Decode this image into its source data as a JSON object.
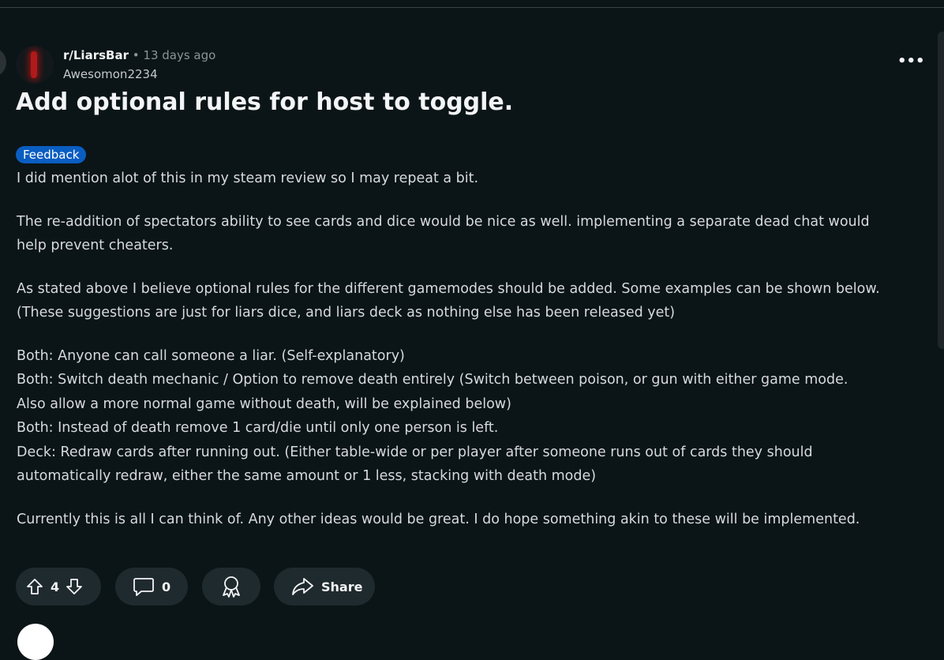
{
  "post": {
    "subreddit": "r/LiarsBar",
    "separator": "•",
    "time": "13 days ago",
    "author": "Awesomon2234",
    "more_label": "•••",
    "title": "Add optional rules for host to toggle.",
    "flair": "Feedback",
    "body": {
      "p1": "I did mention alot of this in my steam review so I may repeat a bit.",
      "p2_l1": "The re-addition of spectators ability to see cards and dice would be nice as well. implementing a separate dead chat would",
      "p2_l2": "help prevent cheaters.",
      "p3_l1": "As stated above I believe optional rules for the different gamemodes should be added. Some examples can be shown below.",
      "p3_l2": "(These suggestions are just for liars dice, and liars deck as nothing else has been released yet)",
      "p4_l1": "Both: Anyone can call someone a liar. (Self-explanatory)",
      "p4_l2": "Both: Switch death mechanic / Option to remove death entirely (Switch between poison, or gun with either game mode.",
      "p4_l3": "Also allow a more normal game without death, will be explained below)",
      "p4_l4": "Both: Instead of death remove 1 card/die until only one person is left.",
      "p4_l5": "Deck: Redraw cards after running out. (Either table-wide or per player after someone runs out of cards they should",
      "p4_l6": "automatically redraw, either the same amount or 1 less, stacking with death mode)",
      "p5": "Currently this is all I can think of. Any other ideas would be great. I do hope something akin to these will be implemented."
    }
  },
  "actions": {
    "votes": "4",
    "comments": "0",
    "share_label": "Share"
  },
  "icons": {
    "upvote": "upvote-arrow-icon",
    "downvote": "downvote-arrow-icon",
    "comment": "comment-bubble-icon",
    "award": "award-ribbon-icon",
    "share": "share-arrow-icon",
    "more": "more-options-icon"
  },
  "colors": {
    "background": "#0b1416",
    "flair": "#0a5ec2",
    "pill": "#1f2a2e",
    "text": "#d7dadc"
  }
}
